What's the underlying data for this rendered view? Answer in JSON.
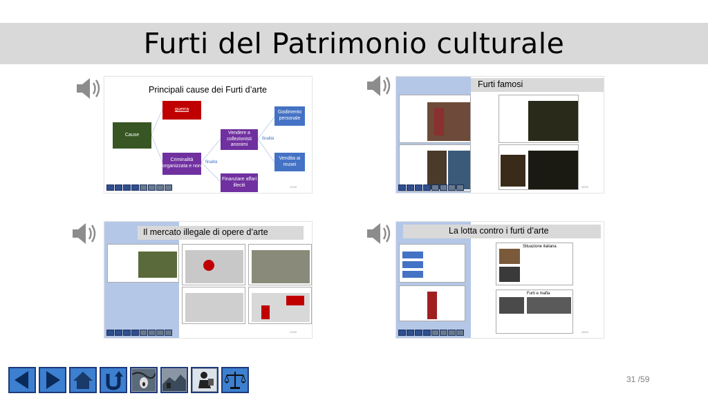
{
  "title": "Furti del Patrimonio culturale",
  "page_number": "31 /59",
  "icons": {
    "speaker": "speaker-icon",
    "nav": [
      "arrow-left-icon",
      "arrow-right-icon",
      "home-icon",
      "return-icon",
      "scream-painting-icon",
      "landscape-painting-icon",
      "thief-icon",
      "justice-scale-icon"
    ]
  },
  "thumbnails": {
    "causes": {
      "title": "Principali cause dei Furti d’arte",
      "cause": "Cause",
      "war": "guerra",
      "crime": "Criminalità organizzata e non",
      "collectors": "Vendere a collezionisti anonimi",
      "enjoyment": "Godimento personale",
      "museum_sale": "Vendita ai musei",
      "finance": "Finanziare affari illeciti",
      "finality1": "finalità",
      "finality2": "finalità",
      "num": "31/59"
    },
    "famous": {
      "title": "Furti famosi",
      "num": "38/59"
    },
    "market": {
      "title": "Il mercato illegale di opere d’arte",
      "num": "31/59"
    },
    "fight": {
      "title": "La lotta contro i furti d’arte",
      "sub1": "Situazione italiana",
      "sub2": "Furti e mafia",
      "num": "38/59"
    }
  },
  "colors": {
    "red": "#c00000",
    "green": "#375623",
    "purple": "#7030a0",
    "blue": "#4472c4",
    "sidebar": "#8eaadb",
    "nav_blue": "#3d7fd0"
  }
}
